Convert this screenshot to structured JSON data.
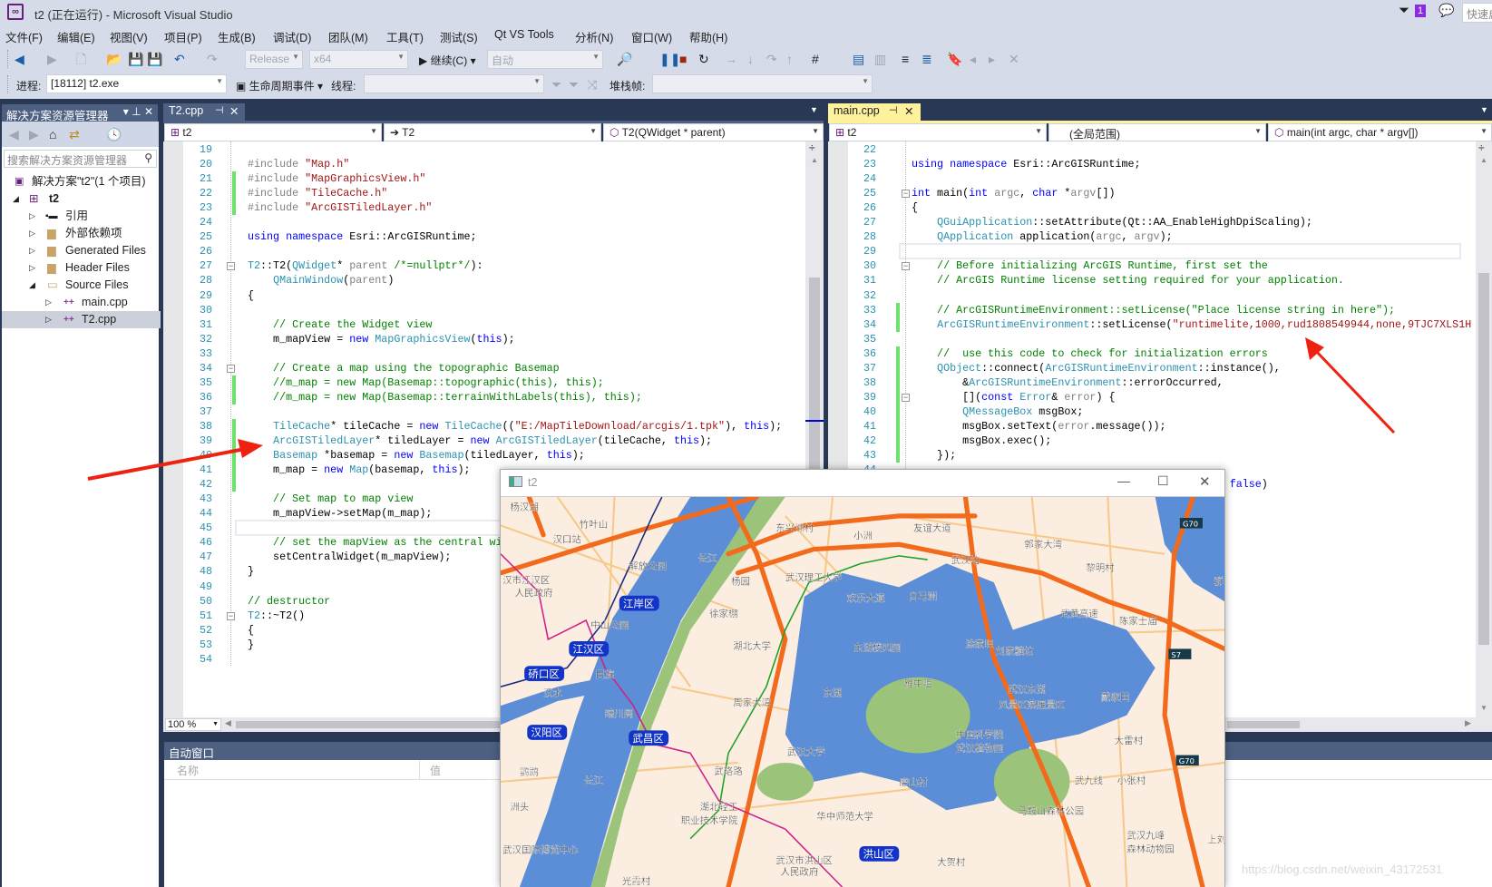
{
  "window": {
    "title": "t2 (正在运行) - Microsoft Visual Studio",
    "notification_count": "1",
    "quick_launch_placeholder": "快速启动"
  },
  "menu": [
    "文件(F)",
    "编辑(E)",
    "视图(V)",
    "项目(P)",
    "生成(B)",
    "调试(D)",
    "团队(M)",
    "工具(T)",
    "测试(S)",
    "Qt VS Tools",
    "分析(N)",
    "窗口(W)",
    "帮助(H)"
  ],
  "toolbar": {
    "configuration": "Release",
    "platform": "x64",
    "continue_label": "继续(C)",
    "auto_combo": "自动"
  },
  "debug_toolbar": {
    "process_label": "进程:",
    "process_value": "[18112] t2.exe",
    "lifecycle_label": "生命周期事件",
    "thread_label": "线程:",
    "stackframe_label": "堆栈帧:"
  },
  "solution_explorer": {
    "title": "解决方案资源管理器",
    "search_placeholder": "搜索解决方案资源管理器",
    "items": [
      {
        "label": "解决方案\"t2\"(1 个项目)"
      },
      {
        "label": "t2"
      },
      {
        "label": "引用"
      },
      {
        "label": "外部依赖项"
      },
      {
        "label": "Generated Files"
      },
      {
        "label": "Header Files"
      },
      {
        "label": "Source Files"
      },
      {
        "label": "main.cpp"
      },
      {
        "label": "T2.cpp"
      }
    ]
  },
  "left_editor": {
    "tab": "T2.cpp",
    "nav_project": "t2",
    "nav_class": "T2",
    "nav_member": "T2(QWidget * parent)",
    "zoom": "100 %",
    "lines": [
      {
        "n": "19",
        "tokens": []
      },
      {
        "n": "20",
        "tokens": [
          [
            "p",
            "#include "
          ],
          [
            "s",
            "\"Map.h\""
          ]
        ]
      },
      {
        "n": "21",
        "tokens": [
          [
            "p",
            "#include "
          ],
          [
            "s",
            "\"MapGraphicsView.h\""
          ]
        ]
      },
      {
        "n": "22",
        "tokens": [
          [
            "p",
            "#include "
          ],
          [
            "s",
            "\"TileCache.h\""
          ]
        ]
      },
      {
        "n": "23",
        "tokens": [
          [
            "p",
            "#include "
          ],
          [
            "s",
            "\"ArcGISTiledLayer.h\""
          ]
        ]
      },
      {
        "n": "24",
        "tokens": []
      },
      {
        "n": "25",
        "tokens": [
          [
            "k",
            "using"
          ],
          [
            "n",
            " "
          ],
          [
            "k",
            "namespace"
          ],
          [
            "n",
            " Esri::ArcGISRuntime;"
          ]
        ]
      },
      {
        "n": "26",
        "tokens": []
      },
      {
        "n": "27",
        "tokens": [
          [
            "t",
            "T2"
          ],
          [
            "n",
            "::T2("
          ],
          [
            "t",
            "QWidget"
          ],
          [
            "n",
            "* "
          ],
          [
            "g",
            "parent"
          ],
          [
            "n",
            " "
          ],
          [
            "c",
            "/*=nullptr*/"
          ],
          [
            "n",
            "):"
          ]
        ]
      },
      {
        "n": "28",
        "tokens": [
          [
            "n",
            "    "
          ],
          [
            "t",
            "QMainWindow"
          ],
          [
            "n",
            "("
          ],
          [
            "g",
            "parent"
          ],
          [
            "n",
            ")"
          ]
        ]
      },
      {
        "n": "29",
        "tokens": [
          [
            "n",
            "{"
          ]
        ]
      },
      {
        "n": "30",
        "tokens": []
      },
      {
        "n": "31",
        "tokens": [
          [
            "c",
            "    // Create the Widget view"
          ]
        ]
      },
      {
        "n": "32",
        "tokens": [
          [
            "n",
            "    m_mapView = "
          ],
          [
            "k",
            "new"
          ],
          [
            "n",
            " "
          ],
          [
            "t",
            "MapGraphicsView"
          ],
          [
            "n",
            "("
          ],
          [
            "k",
            "this"
          ],
          [
            "n",
            ");"
          ]
        ]
      },
      {
        "n": "33",
        "tokens": []
      },
      {
        "n": "34",
        "tokens": [
          [
            "c",
            "    // Create a map using the topographic Basemap"
          ]
        ]
      },
      {
        "n": "35",
        "tokens": [
          [
            "c",
            "    //m_map = new Map(Basemap::topographic(this), this);"
          ]
        ]
      },
      {
        "n": "36",
        "tokens": [
          [
            "c",
            "    //m_map = new Map(Basemap::terrainWithLabels(this), this);"
          ]
        ]
      },
      {
        "n": "37",
        "tokens": []
      },
      {
        "n": "38",
        "tokens": [
          [
            "n",
            "    "
          ],
          [
            "t",
            "TileCache"
          ],
          [
            "n",
            "* tileCache = "
          ],
          [
            "k",
            "new"
          ],
          [
            "n",
            " "
          ],
          [
            "t",
            "TileCache"
          ],
          [
            "n",
            "(("
          ],
          [
            "s",
            "\"E:/MapTileDownload/arcgis/1.tpk\""
          ],
          [
            "n",
            "), "
          ],
          [
            "k",
            "this"
          ],
          [
            "n",
            ");"
          ]
        ]
      },
      {
        "n": "39",
        "tokens": [
          [
            "n",
            "    "
          ],
          [
            "t",
            "ArcGISTiledLayer"
          ],
          [
            "n",
            "* tiledLayer = "
          ],
          [
            "k",
            "new"
          ],
          [
            "n",
            " "
          ],
          [
            "t",
            "ArcGISTiledLayer"
          ],
          [
            "n",
            "(tileCache, "
          ],
          [
            "k",
            "this"
          ],
          [
            "n",
            ");"
          ]
        ]
      },
      {
        "n": "40",
        "tokens": [
          [
            "n",
            "    "
          ],
          [
            "t",
            "Basemap"
          ],
          [
            "n",
            " *basemap = "
          ],
          [
            "k",
            "new"
          ],
          [
            "n",
            " "
          ],
          [
            "t",
            "Basemap"
          ],
          [
            "n",
            "(tiledLayer, "
          ],
          [
            "k",
            "this"
          ],
          [
            "n",
            ");"
          ]
        ]
      },
      {
        "n": "41",
        "tokens": [
          [
            "n",
            "    m_map = "
          ],
          [
            "k",
            "new"
          ],
          [
            "n",
            " "
          ],
          [
            "t",
            "Map"
          ],
          [
            "n",
            "(basemap, "
          ],
          [
            "k",
            "this"
          ],
          [
            "n",
            ");"
          ]
        ]
      },
      {
        "n": "42",
        "tokens": []
      },
      {
        "n": "43",
        "tokens": [
          [
            "c",
            "    // Set map to map view"
          ]
        ]
      },
      {
        "n": "44",
        "tokens": [
          [
            "n",
            "    m_mapView->setMap(m_map);"
          ]
        ]
      },
      {
        "n": "45",
        "tokens": []
      },
      {
        "n": "46",
        "tokens": [
          [
            "c",
            "    // set the mapView as the central wi"
          ]
        ]
      },
      {
        "n": "47",
        "tokens": [
          [
            "n",
            "    setCentralWidget(m_mapView);"
          ]
        ]
      },
      {
        "n": "48",
        "tokens": [
          [
            "n",
            "}"
          ]
        ]
      },
      {
        "n": "49",
        "tokens": []
      },
      {
        "n": "50",
        "tokens": [
          [
            "c",
            "// destructor"
          ]
        ]
      },
      {
        "n": "51",
        "tokens": [
          [
            "t",
            "T2"
          ],
          [
            "n",
            "::~T2()"
          ]
        ]
      },
      {
        "n": "52",
        "tokens": [
          [
            "n",
            "{"
          ]
        ]
      },
      {
        "n": "53",
        "tokens": [
          [
            "n",
            "}"
          ]
        ]
      },
      {
        "n": "54",
        "tokens": []
      }
    ]
  },
  "right_editor": {
    "tab": "main.cpp",
    "nav_project": "t2",
    "nav_scope": "(全局范围)",
    "nav_member": "main(int argc, char * argv[])",
    "lines": [
      {
        "n": "22",
        "tokens": []
      },
      {
        "n": "23",
        "tokens": [
          [
            "k",
            "using"
          ],
          [
            "n",
            " "
          ],
          [
            "k",
            "namespace"
          ],
          [
            "n",
            " Esri::ArcGISRuntime;"
          ]
        ]
      },
      {
        "n": "24",
        "tokens": []
      },
      {
        "n": "25",
        "tokens": [
          [
            "k",
            "int"
          ],
          [
            "n",
            " main("
          ],
          [
            "k",
            "int"
          ],
          [
            "n",
            " "
          ],
          [
            "g",
            "argc"
          ],
          [
            "n",
            ", "
          ],
          [
            "k",
            "char"
          ],
          [
            "n",
            " *"
          ],
          [
            "g",
            "argv"
          ],
          [
            "n",
            "[])"
          ]
        ]
      },
      {
        "n": "26",
        "tokens": [
          [
            "n",
            "{"
          ]
        ]
      },
      {
        "n": "27",
        "tokens": [
          [
            "n",
            "    "
          ],
          [
            "t",
            "QGuiApplication"
          ],
          [
            "n",
            "::setAttribute(Qt::AA_EnableHighDpiScaling);"
          ]
        ]
      },
      {
        "n": "28",
        "tokens": [
          [
            "n",
            "    "
          ],
          [
            "t",
            "QApplication"
          ],
          [
            "n",
            " application("
          ],
          [
            "g",
            "argc"
          ],
          [
            "n",
            ", "
          ],
          [
            "g",
            "argv"
          ],
          [
            "n",
            ");"
          ]
        ]
      },
      {
        "n": "29",
        "tokens": []
      },
      {
        "n": "30",
        "tokens": [
          [
            "c",
            "    // Before initializing ArcGIS Runtime, first set the"
          ]
        ]
      },
      {
        "n": "31",
        "tokens": [
          [
            "c",
            "    // ArcGIS Runtime license setting required for your application."
          ]
        ]
      },
      {
        "n": "32",
        "tokens": []
      },
      {
        "n": "33",
        "tokens": [
          [
            "c",
            "    // ArcGISRuntimeEnvironment::setLicense(\"Place license string in here\");"
          ]
        ]
      },
      {
        "n": "34",
        "tokens": [
          [
            "n",
            "    "
          ],
          [
            "t",
            "ArcGISRuntimeEnvironment"
          ],
          [
            "n",
            "::setLicense("
          ],
          [
            "s",
            "\"runtimelite,1000,rud1808549944,none,9TJC7XLS1H"
          ]
        ]
      },
      {
        "n": "35",
        "tokens": []
      },
      {
        "n": "36",
        "tokens": [
          [
            "c",
            "    //  use this code to check for initialization errors"
          ]
        ]
      },
      {
        "n": "37",
        "tokens": [
          [
            "n",
            "    "
          ],
          [
            "t",
            "QObject"
          ],
          [
            "n",
            "::connect("
          ],
          [
            "t",
            "ArcGISRuntimeEnvironment"
          ],
          [
            "n",
            "::instance(),"
          ]
        ]
      },
      {
        "n": "38",
        "tokens": [
          [
            "n",
            "        &"
          ],
          [
            "t",
            "ArcGISRuntimeEnvironment"
          ],
          [
            "n",
            "::errorOccurred,"
          ]
        ]
      },
      {
        "n": "39",
        "tokens": [
          [
            "n",
            "        []("
          ],
          [
            "k",
            "const"
          ],
          [
            "n",
            " "
          ],
          [
            "t",
            "Error"
          ],
          [
            "n",
            "& "
          ],
          [
            "g",
            "error"
          ],
          [
            "n",
            ") {"
          ]
        ]
      },
      {
        "n": "40",
        "tokens": [
          [
            "n",
            "        "
          ],
          [
            "t",
            "QMessageBox"
          ],
          [
            "n",
            " msgBox;"
          ]
        ]
      },
      {
        "n": "41",
        "tokens": [
          [
            "n",
            "        msgBox.setText("
          ],
          [
            "g",
            "error"
          ],
          [
            "n",
            ".message());"
          ]
        ]
      },
      {
        "n": "42",
        "tokens": [
          [
            "n",
            "        msgBox.exec();"
          ]
        ]
      },
      {
        "n": "43",
        "tokens": [
          [
            "n",
            "    });"
          ]
        ]
      },
      {
        "n": "44",
        "tokens": []
      },
      {
        "n": "45",
        "tokens": [
          [
            "n",
            "                                                  "
          ],
          [
            "k",
            "false"
          ],
          [
            "n",
            ")"
          ]
        ]
      }
    ]
  },
  "autos_window": {
    "title": "自动窗口",
    "col_name": "名称",
    "col_value": "值"
  },
  "map_window": {
    "title": "t2",
    "district_badges": [
      "江岸区",
      "江汉区",
      "硚口区",
      "汉阳区",
      "武昌区",
      "洪山区"
    ],
    "place_labels": [
      "杨汉湖",
      "竹叶山",
      "汉口站",
      "解放公园",
      "汉市江汉区",
      "人民政府",
      "中山公园",
      "民族",
      "汉水",
      "晴川阁",
      "鹦鹉",
      "洲头",
      "武汉国际博览中心",
      "东兴洲村",
      "杨园",
      "武汉理工大学",
      "徐家棚",
      "湖北大学",
      "小洲",
      "友谊大道",
      "武汉站",
      "白马洲",
      "欢乐大道",
      "东湖楼风园",
      "东湖",
      "周家大湾",
      "涂家咀",
      "刘家糖坊",
      "雁中咀",
      "武汉东湖",
      "风景区落雁景区",
      "郭家大湾",
      "黎明村",
      "陈家士庙",
      "戴家田",
      "大雷村",
      "中国科学院",
      "武汉植物园",
      "武汉大学",
      "磨山村",
      "湖北轻工",
      "职业技术学院",
      "华中师范大学",
      "马鞍山森林公园",
      "武汉市洪山区",
      "人民政府",
      "武汉九峰",
      "森林动物园",
      "大贺村",
      "武九线",
      "小张村",
      "上刘村",
      "群",
      "武黄高速",
      "长江",
      "长江",
      "光霞村",
      "武珞路"
    ],
    "road_shields": [
      "G70",
      "S7",
      "G70"
    ]
  },
  "watermark": "https://blog.csdn.net/weixin_43172531",
  "colors": {
    "vs_background": "#293955",
    "chrome": "#d6dbe9",
    "tool_header": "#4d6082",
    "active_tab": "#fff29d",
    "change_bar": "#6ce26c",
    "annotation_arrow": "#ee2211"
  }
}
